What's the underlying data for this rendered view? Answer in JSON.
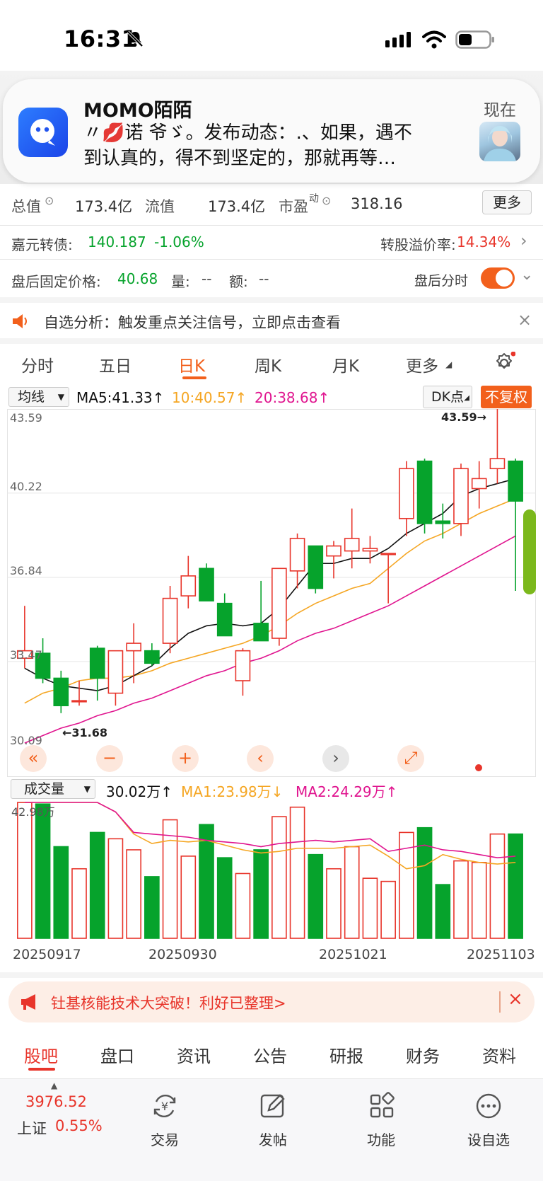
{
  "status_bar": {
    "time": "16:31"
  },
  "notification": {
    "app": "MOMO陌陌",
    "time": "现在",
    "body": "〃💋诺 爷ゞ。发布动态：.、如果，遇不\n到认真的，得不到坚定的，那就再等…"
  },
  "stats": {
    "total_label": "总值",
    "total_value": "173.4亿",
    "float_label": "流值",
    "float_value": "173.4亿",
    "pe_label": "市盈",
    "pe_sup": "动",
    "pe_value": "318.16",
    "more": "更多"
  },
  "bond": {
    "label": "嘉元转债:",
    "price": "140.187",
    "change": "-1.06%",
    "premium_label": "转股溢价率:",
    "premium_value": "14.34%"
  },
  "after_hours": {
    "label": "盘后固定价格:",
    "price": "40.68",
    "vol_label": "量:",
    "vol_value": "--",
    "amt_label": "额:",
    "amt_value": "--",
    "toggle_label": "盘后分时",
    "toggle_on": true
  },
  "alert": {
    "text": "自选分析：触发重点关注信号，立即点击查看"
  },
  "period_tabs": [
    "分时",
    "五日",
    "日K",
    "周K",
    "月K",
    "更多"
  ],
  "active_period": "日K",
  "ma_legend": {
    "select": "均线",
    "ma5": "MA5:41.33↑",
    "ma10": "10:40.57↑",
    "ma20": "20:38.68↑",
    "dk": "DK点",
    "fuquan": "不复权"
  },
  "vol_legend": {
    "select": "成交量",
    "vol": "30.02万↑",
    "ma1": "MA1:23.98万↓",
    "ma2": "MA2:24.29万↑",
    "max_label": "42.98万"
  },
  "promo": {
    "text": "钍基核能技术大突破！利好已整理>"
  },
  "bottom_tabs": [
    "股吧",
    "盘口",
    "资讯",
    "公告",
    "研报",
    "财务",
    "资料"
  ],
  "bottom_bar": {
    "index_value": "3976.52",
    "index_name": "上证",
    "index_change": "0.55%",
    "items": [
      "交易",
      "发帖",
      "功能",
      "设自选"
    ]
  },
  "colors": {
    "accent": "#f2601c",
    "up": "#e8352b",
    "down": "#06a32c",
    "ma5": "#111111",
    "ma10": "#f5a623",
    "ma20": "#e0158f"
  },
  "chart_data": {
    "type": "candlestick",
    "y_ticks": [
      "43.59",
      "40.22",
      "36.84",
      "33.47",
      "30.09"
    ],
    "ylim": [
      30.09,
      43.59
    ],
    "high_annotation": "43.59→",
    "low_annotation": "←31.68",
    "x_ticks": [
      "20250917",
      "20250930",
      "20251021",
      "20251103"
    ],
    "candles": [
      {
        "o": 33.6,
        "h": 35.7,
        "l": 33.2,
        "c": 33.9
      },
      {
        "o": 33.8,
        "h": 34.4,
        "l": 32.6,
        "c": 32.8
      },
      {
        "o": 32.8,
        "h": 33.1,
        "l": 31.4,
        "c": 31.7
      },
      {
        "o": 31.9,
        "h": 32.7,
        "l": 31.7,
        "c": 31.9
      },
      {
        "o": 34.0,
        "h": 34.1,
        "l": 31.9,
        "c": 32.8
      },
      {
        "o": 32.2,
        "h": 33.9,
        "l": 31.7,
        "c": 33.9
      },
      {
        "o": 33.9,
        "h": 35.0,
        "l": 32.6,
        "c": 34.2
      },
      {
        "o": 33.9,
        "h": 34.2,
        "l": 33.3,
        "c": 33.4
      },
      {
        "o": 34.2,
        "h": 36.5,
        "l": 33.8,
        "c": 36.0
      },
      {
        "o": 36.1,
        "h": 37.7,
        "l": 35.6,
        "c": 36.9
      },
      {
        "o": 37.2,
        "h": 37.4,
        "l": 35.9,
        "c": 35.9
      },
      {
        "o": 35.8,
        "h": 36.2,
        "l": 34.5,
        "c": 34.5
      },
      {
        "o": 32.7,
        "h": 34.0,
        "l": 32.1,
        "c": 33.9
      },
      {
        "o": 35.0,
        "h": 36.7,
        "l": 34.3,
        "c": 34.3
      },
      {
        "o": 34.4,
        "h": 37.2,
        "l": 34.1,
        "c": 37.2
      },
      {
        "o": 37.1,
        "h": 38.6,
        "l": 36.4,
        "c": 38.4
      },
      {
        "o": 38.1,
        "h": 38.1,
        "l": 36.2,
        "c": 36.4
      },
      {
        "o": 37.7,
        "h": 38.3,
        "l": 36.8,
        "c": 38.1
      },
      {
        "o": 37.9,
        "h": 39.6,
        "l": 37.2,
        "c": 38.4
      },
      {
        "o": 37.9,
        "h": 38.5,
        "l": 37.4,
        "c": 38.0
      },
      {
        "o": 37.8,
        "h": 37.8,
        "l": 35.8,
        "c": 37.8
      },
      {
        "o": 39.2,
        "h": 41.5,
        "l": 38.5,
        "c": 41.2
      },
      {
        "o": 41.5,
        "h": 41.6,
        "l": 38.6,
        "c": 39.0
      },
      {
        "o": 39.1,
        "h": 39.8,
        "l": 38.4,
        "c": 39.0
      },
      {
        "o": 39.0,
        "h": 41.4,
        "l": 38.5,
        "c": 41.2
      },
      {
        "o": 40.4,
        "h": 41.5,
        "l": 39.6,
        "c": 40.8
      },
      {
        "o": 41.2,
        "h": 43.59,
        "l": 40.6,
        "c": 41.6
      },
      {
        "o": 41.5,
        "h": 41.6,
        "l": 36.3,
        "c": 39.9
      }
    ],
    "ma5": [
      33.2,
      32.8,
      32.5,
      32.4,
      32.3,
      32.5,
      32.9,
      33.3,
      34.0,
      34.6,
      34.9,
      35.0,
      34.9,
      35.0,
      35.6,
      36.5,
      37.4,
      37.4,
      37.6,
      37.6,
      38.0,
      38.6,
      39.0,
      39.4,
      40.1,
      40.4,
      40.6,
      40.8
    ],
    "ma10": [
      31.8,
      32.2,
      32.4,
      32.7,
      32.8,
      32.8,
      32.9,
      33.1,
      33.4,
      33.6,
      33.8,
      34.0,
      34.2,
      34.5,
      34.9,
      35.4,
      35.8,
      36.1,
      36.4,
      36.6,
      37.2,
      37.8,
      38.3,
      38.6,
      39.0,
      39.4,
      39.7,
      40.0
    ],
    "ma20": [
      30.2,
      30.5,
      30.8,
      31.0,
      31.3,
      31.5,
      31.8,
      32.0,
      32.3,
      32.6,
      32.9,
      33.1,
      33.4,
      33.6,
      33.9,
      34.3,
      34.6,
      34.8,
      35.1,
      35.4,
      35.7,
      36.1,
      36.5,
      36.9,
      37.3,
      37.7,
      38.1,
      38.5
    ],
    "volume": [
      42.98,
      42.5,
      29.0,
      22.0,
      33.5,
      31.5,
      28.0,
      19.5,
      37.5,
      26.0,
      36.0,
      25.5,
      20.5,
      28.0,
      38.5,
      41.5,
      26.5,
      22.0,
      29.0,
      19.0,
      18.0,
      33.5,
      35.0,
      17.0,
      24.5,
      24.0,
      33.0,
      33.0
    ],
    "vol_ma1": [
      43.0,
      43.0,
      43.0,
      43.0,
      43.0,
      40.0,
      33.0,
      30.0,
      31.0,
      30.5,
      31.0,
      29.5,
      28.0,
      27.0,
      27.5,
      28.5,
      28.5,
      28.5,
      29.0,
      29.5,
      26.0,
      22.0,
      23.0,
      26.5,
      25.0,
      24.0,
      23.5,
      24.0
    ],
    "vol_ma2": [
      43.0,
      43.0,
      43.0,
      43.0,
      43.0,
      40.0,
      33.5,
      33.0,
      32.5,
      32.0,
      31.0,
      30.5,
      30.0,
      29.0,
      30.0,
      30.5,
      31.0,
      30.5,
      31.0,
      31.5,
      27.5,
      28.5,
      29.5,
      28.0,
      27.5,
      26.5,
      25.5,
      26.0
    ]
  }
}
